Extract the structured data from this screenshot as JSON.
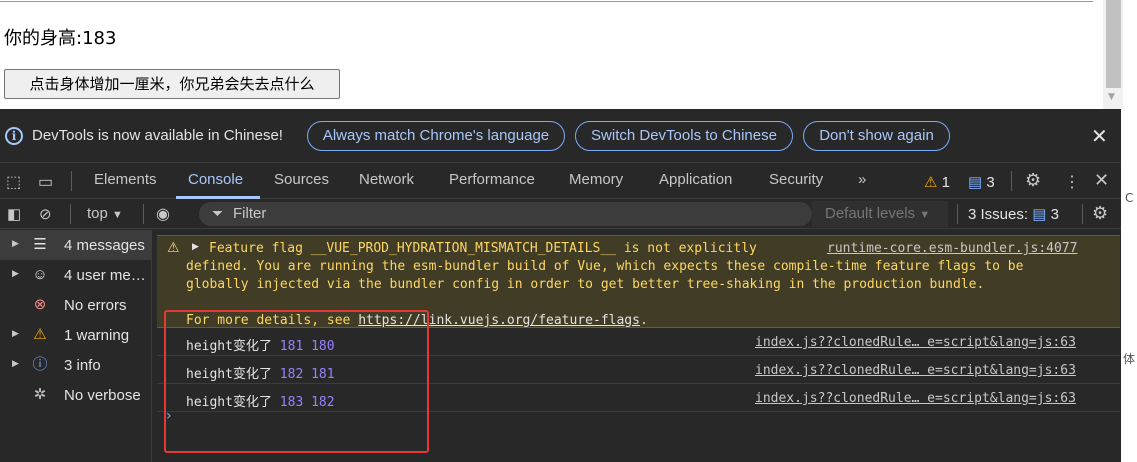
{
  "page": {
    "height_text": "你的身高:183",
    "button_label": "点击身体增加一厘米，你兄弟会失去点什么"
  },
  "infobar": {
    "message": "DevTools is now available in Chinese!",
    "btn_match": "Always match Chrome's language",
    "btn_switch": "Switch DevTools to Chinese",
    "btn_dont_show": "Don't show again"
  },
  "tabs": [
    {
      "label": "Elements"
    },
    {
      "label": "Console"
    },
    {
      "label": "Sources"
    },
    {
      "label": "Network"
    },
    {
      "label": "Performance"
    },
    {
      "label": "Memory"
    },
    {
      "label": "Application"
    },
    {
      "label": "Security"
    }
  ],
  "tab_active": "Console",
  "badges": {
    "warnings": "1",
    "messages": "3"
  },
  "toolbar": {
    "context": "top",
    "filter_placeholder": "Filter",
    "levels": "Default levels",
    "issues_label": "3 Issues:",
    "issues_count": "3"
  },
  "sidebar": [
    {
      "label": "4 messages",
      "icon": "list-icon"
    },
    {
      "label": "4 user me…",
      "icon": "user-icon"
    },
    {
      "label": "No errors",
      "icon": "error-icon"
    },
    {
      "label": "1 warning",
      "icon": "warning-icon"
    },
    {
      "label": "3 info",
      "icon": "info-icon"
    },
    {
      "label": "No verbose",
      "icon": "bug-icon"
    }
  ],
  "warning": {
    "line1": "Feature flag __VUE_PROD_HYDRATION_MISMATCH_DETAILS__ is not explicitly",
    "line2": "defined. You are running the esm-bundler build of Vue, which expects these compile-time feature flags to be",
    "line3": "globally injected via the bundler config in order to get better tree-shaking in the production bundle.",
    "line4_prefix": "For more details, see ",
    "line4_url": "https://link.vuejs.org/feature-flags",
    "line4_suffix": ".",
    "source": "runtime-core.esm-bundler.js:4077"
  },
  "logs": [
    {
      "text": "height变化了 ",
      "nums": "181 180",
      "source": "index.js??clonedRule… e=script&lang=js:63"
    },
    {
      "text": "height变化了 ",
      "nums": "182 181",
      "source": "index.js??clonedRule… e=script&lang=js:63"
    },
    {
      "text": "height变化了 ",
      "nums": "183 182",
      "source": "index.js??clonedRule… e=script&lang=js:63"
    }
  ],
  "prompt_symbol": "›",
  "colors": {
    "devtools_bg": "#282828",
    "accent": "#a8c7fa",
    "warning": "#fdd663",
    "number": "#9980ff",
    "highlight": "#e53935"
  }
}
